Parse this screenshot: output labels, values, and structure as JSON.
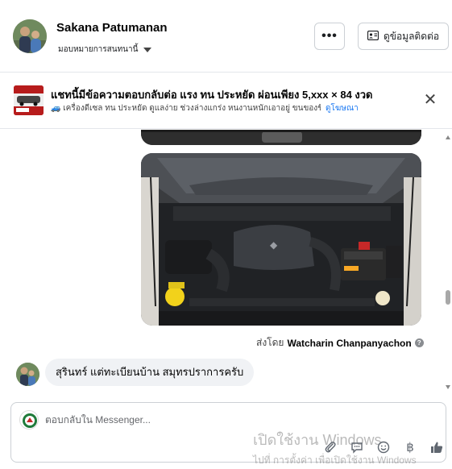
{
  "header": {
    "user_name": "Sakana Patumanan",
    "assign_label": "มอบหมายการสนทนานี้",
    "more_label": "•••",
    "contact_label": "ดูข้อมูลติดต่อ"
  },
  "ad": {
    "title": "แชทนี้มีข้อความตอบกลับต่อ แรง ทน ประหยัด ผ่อนเพียง 5,xxx × 84 งวด",
    "desc": "🚙 เครื่องดีเซล ทน ประหยัด ดูแลง่าย ช่วงล่างแกร่ง หนงานหนักเอาอยู่ ขนของขึ้นเ...",
    "link": "ดูโฆษณา",
    "close": "✕"
  },
  "chat": {
    "sent_prefix": "ส่งโดย",
    "sent_by": "Watcharin Chanpanyachon",
    "help": "?",
    "message": "สุรินทร์ แต่ทะเบียนบ้าน สมุทรปราการครับ"
  },
  "composer": {
    "placeholder": "ตอบกลับใน Messenger...",
    "watermark_line1": "เปิดใช้งาน Windows",
    "watermark_line2": "ไปที่ การตั้งค่า เพื่อเปิดใช้งาน Windows",
    "tools": [
      "paperclip-icon",
      "chat-bubble-icon",
      "emoji-icon",
      "baht-icon",
      "like-icon"
    ],
    "baht_symbol": "฿"
  },
  "colors": {
    "accent": "#1877f2",
    "bubble": "#f0f2f5",
    "border": "#ccd0d5",
    "ad_thumb": "#b71c1c"
  }
}
